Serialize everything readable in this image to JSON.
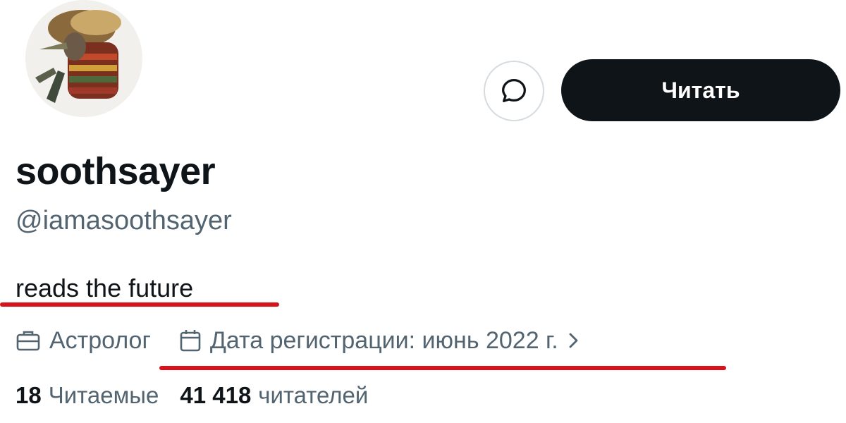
{
  "profile": {
    "display_name": "soothsayer",
    "handle": "@iamasoothsayer",
    "bio": "reads the future",
    "profession": "Астролог",
    "joined": "Дата регистрации: июнь 2022 г.",
    "avatar_icon": "avatar-image"
  },
  "actions": {
    "message_icon": "message-bubble-icon",
    "follow_label": "Читать"
  },
  "stats": {
    "following_count": "18",
    "following_label": "Читаемые",
    "followers_count": "41 418",
    "followers_label": "читателей"
  },
  "colors": {
    "text_primary": "#0f1419",
    "text_secondary": "#536471",
    "button_dark": "#0f1419",
    "annotation_red": "#d8121a"
  }
}
